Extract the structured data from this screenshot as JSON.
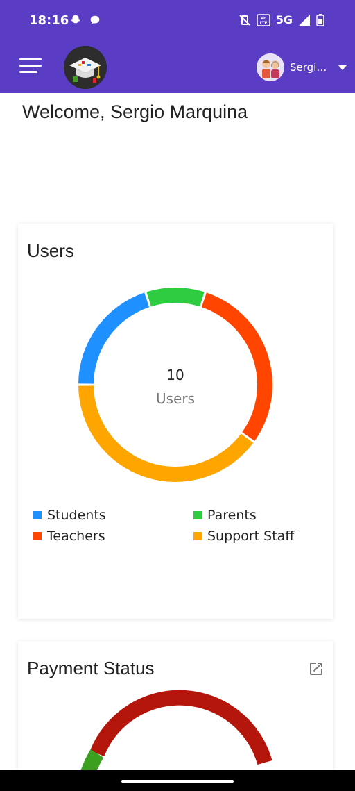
{
  "status_bar": {
    "time": "18:16",
    "network": "5G",
    "icons": [
      "snapchat-icon",
      "chat-bubble-icon",
      "vibrate-off-icon",
      "volte-icon",
      "signal-icon",
      "battery-icon"
    ]
  },
  "app_bar": {
    "menu_icon": "hamburger-menu-icon",
    "logo": "graduation-cap-logo",
    "user_name": "Sergio Marquina",
    "user_dropdown_icon": "caret-down-icon"
  },
  "welcome_text": "Welcome, Sergio Marquina",
  "users_card": {
    "title": "Users",
    "total": "10",
    "center_label": "Users",
    "legend": [
      {
        "label": "Students",
        "color": "#1e90ff"
      },
      {
        "label": "Parents",
        "color": "#2ecc40"
      },
      {
        "label": "Teachers",
        "color": "#ff4500"
      },
      {
        "label": "Support Staff",
        "color": "#ffa500"
      }
    ]
  },
  "payment_card": {
    "title": "Payment Status",
    "open_icon": "external-link-icon"
  },
  "colors": {
    "primary": "#5b3cc4",
    "paid_red": "#b5160c",
    "green": "#3aa01d"
  },
  "chart_data": [
    {
      "type": "pie",
      "title": "Users",
      "categories": [
        "Students",
        "Parents",
        "Teachers",
        "Support Staff"
      ],
      "values": [
        2,
        1,
        3,
        4
      ],
      "colors": [
        "#1e90ff",
        "#2ecc40",
        "#ff4500",
        "#ffa500"
      ],
      "legend_position": "bottom"
    }
  ]
}
